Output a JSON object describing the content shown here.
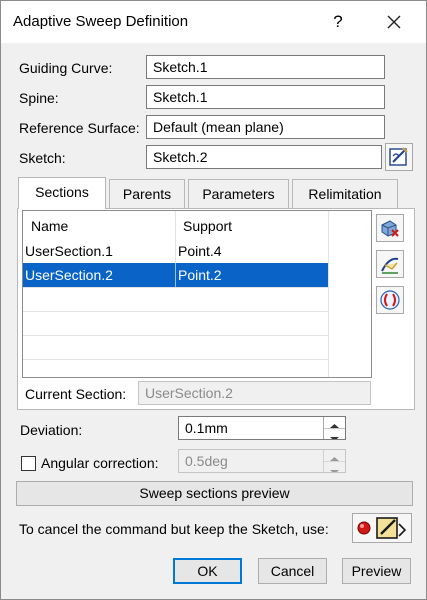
{
  "window": {
    "title": "Adaptive Sweep Definition",
    "help": "?",
    "close_icon": "close-icon"
  },
  "fields": {
    "guiding_curve": {
      "label": "Guiding Curve:",
      "value": "Sketch.1"
    },
    "spine": {
      "label": "Spine:",
      "value": "Sketch.1"
    },
    "reference_surface": {
      "label": "Reference Surface:",
      "value": "Default (mean plane)"
    },
    "sketch": {
      "label": "Sketch:",
      "value": "Sketch.2",
      "icon": "edit-sketch-icon"
    }
  },
  "tabs": [
    {
      "label": "Sections",
      "active": true
    },
    {
      "label": "Parents",
      "active": false
    },
    {
      "label": "Parameters",
      "active": false
    },
    {
      "label": "Relimitation",
      "active": false
    }
  ],
  "sections_table": {
    "columns": [
      "Name",
      "Support"
    ],
    "rows": [
      {
        "name": "UserSection.1",
        "support": "Point.4",
        "selected": false
      },
      {
        "name": "UserSection.2",
        "support": "Point.2",
        "selected": true
      }
    ]
  },
  "side_icons": [
    "delete-section-icon",
    "add-section-icon",
    "parameters-icon"
  ],
  "current_section": {
    "label": "Current Section:",
    "value": "UserSection.2"
  },
  "deviation": {
    "label": "Deviation:",
    "value": "0.1mm"
  },
  "angular_correction": {
    "label": "Angular correction:",
    "value": "0.5deg",
    "checked": false
  },
  "sweep_preview_button": "Sweep sections preview",
  "cancel_hint": {
    "text": "To cancel the command but keep the Sketch, use:",
    "icon": "record-sketch-icon"
  },
  "buttons": {
    "ok": "OK",
    "cancel": "Cancel",
    "preview": "Preview"
  },
  "colors": {
    "selection": "#0a64c8",
    "dialog_bg": "#f0f0f0",
    "default_button_border": "#0078d7"
  }
}
